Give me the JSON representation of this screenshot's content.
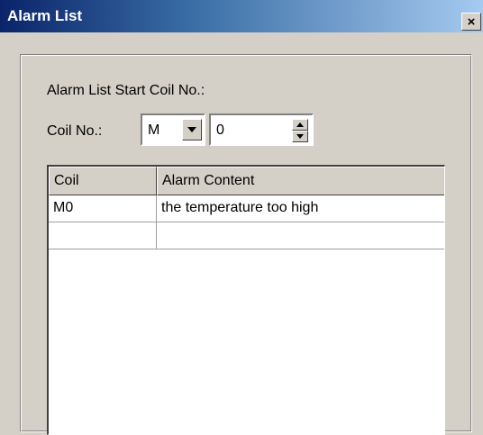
{
  "window": {
    "title": "Alarm List",
    "close_glyph": "×"
  },
  "form": {
    "start_label": "Alarm List Start Coil No.:",
    "coil_label": "Coil No.:",
    "coil_type": "M",
    "coil_number": "0"
  },
  "table": {
    "columns": [
      "Coil",
      "Alarm Content"
    ],
    "rows": [
      {
        "coil": "M0",
        "content": "the temperature too high"
      },
      {
        "coil": "",
        "content": ""
      }
    ]
  },
  "icons": [
    "close-icon",
    "chevron-down-icon",
    "spin-up-icon",
    "spin-down-icon"
  ],
  "colors": {
    "title_start": "#0a246a",
    "title_end": "#a6caf0",
    "face": "#d4d0c8"
  }
}
